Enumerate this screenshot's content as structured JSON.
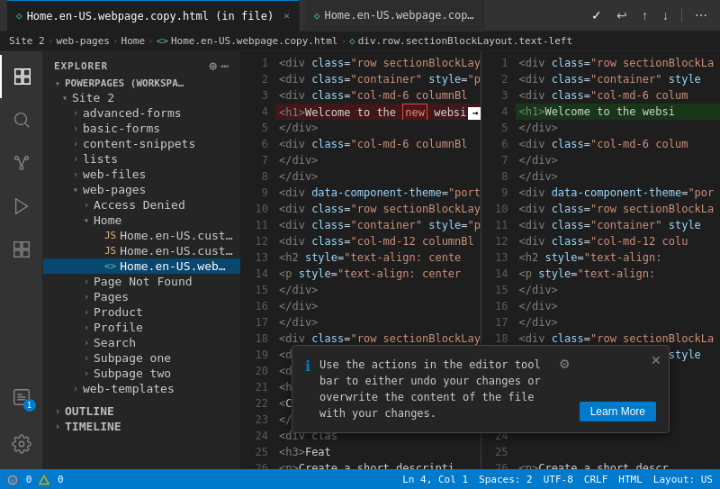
{
  "titlebar": {
    "tab1_icon": "◇",
    "tab1_label": "Home.en-US.webpage.copy.html (in file)",
    "tab2_icon": "◇",
    "tab2_label": "Home.en-US.webpage.cop…",
    "btn_check": "✓",
    "btn_undo": "↩",
    "btn_up": "↑",
    "btn_down": "↓",
    "btn_more": "⋯"
  },
  "breadcrumb": {
    "parts": [
      "Site 2",
      ">",
      "web-pages",
      ">",
      "Home",
      ">",
      "<>",
      "Home.en-US.webpage.copy.html",
      ">",
      "◇",
      "div.row.sectionBlockLayout.text-left"
    ]
  },
  "activitybar": {
    "icons": [
      "⎘",
      "🔍",
      "◉",
      "⑂",
      "🐛",
      "⊞",
      "⚙"
    ],
    "bottom_icons": [
      "🔔",
      "👤"
    ]
  },
  "sidebar": {
    "header": "EXPLORER",
    "workspace": "POWERPAGES (WORKSPA…",
    "items": [
      {
        "label": "Site 2",
        "level": 1,
        "expanded": true,
        "arrow": "▾"
      },
      {
        "label": "advanced-forms",
        "level": 2,
        "expanded": false,
        "arrow": "›"
      },
      {
        "label": "basic-forms",
        "level": 2,
        "expanded": false,
        "arrow": "›"
      },
      {
        "label": "content-snippets",
        "level": 2,
        "expanded": false,
        "arrow": "›"
      },
      {
        "label": "lists",
        "level": 2,
        "expanded": false,
        "arrow": "›"
      },
      {
        "label": "web-files",
        "level": 2,
        "expanded": false,
        "arrow": "›"
      },
      {
        "label": "web-pages",
        "level": 2,
        "expanded": true,
        "arrow": "▾"
      },
      {
        "label": "Access Denied",
        "level": 3,
        "expanded": false,
        "arrow": "›"
      },
      {
        "label": "Home",
        "level": 3,
        "expanded": true,
        "arrow": "▾"
      },
      {
        "label": "Home.en-US.cust…",
        "level": 4,
        "expanded": false,
        "arrow": "",
        "icon": "JS"
      },
      {
        "label": "Home.en-US.cust…",
        "level": 4,
        "expanded": false,
        "arrow": "",
        "icon": "JS"
      },
      {
        "label": "Home.en-US.web…",
        "level": 4,
        "expanded": false,
        "arrow": "",
        "icon": "<>",
        "selected": true
      },
      {
        "label": "Page Not Found",
        "level": 3,
        "expanded": false,
        "arrow": "›"
      },
      {
        "label": "Pages",
        "level": 3,
        "expanded": false,
        "arrow": "›"
      },
      {
        "label": "Product",
        "level": 3,
        "expanded": false,
        "arrow": "›"
      },
      {
        "label": "Profile",
        "level": 3,
        "expanded": false,
        "arrow": "›"
      },
      {
        "label": "Search",
        "level": 3,
        "expanded": false,
        "arrow": "›"
      },
      {
        "label": "Subpage one",
        "level": 3,
        "expanded": false,
        "arrow": "›"
      },
      {
        "label": "Subpage two",
        "level": 3,
        "expanded": false,
        "arrow": "›"
      },
      {
        "label": "web-templates",
        "level": 2,
        "expanded": false,
        "arrow": "›"
      }
    ],
    "outline": "OUTLINE",
    "timeline": "TIMELINE"
  },
  "code_left": {
    "lines": [
      {
        "num": 1,
        "text": "  <div class=\"row sectionBlockLayou"
      },
      {
        "num": 2,
        "text": "    <div class=\"container\" style=\"p"
      },
      {
        "num": 3,
        "text": "      <div class=\"col-md-6 columnBl"
      },
      {
        "num": 4,
        "text": "        <h1>Welcome to the new websi",
        "highlight": "red"
      },
      {
        "num": 5,
        "text": "      </div>"
      },
      {
        "num": 6,
        "text": "      <div class=\"col-md-6 columnBl"
      },
      {
        "num": 7,
        "text": "    </div>"
      },
      {
        "num": 8,
        "text": "  </div>"
      },
      {
        "num": 9,
        "text": "  <div data-component-theme=\"portal"
      },
      {
        "num": 10,
        "text": "    <div class=\"row sectionBlockLayou"
      },
      {
        "num": 11,
        "text": "      <div class=\"container\" style=\"p"
      },
      {
        "num": 12,
        "text": "        <div class=\"col-md-12 columnBl"
      },
      {
        "num": 13,
        "text": "          <h2 style=\"text-align: cente"
      },
      {
        "num": 14,
        "text": "          <p style=\"text-align: center"
      },
      {
        "num": 15,
        "text": "        </div>"
      },
      {
        "num": 16,
        "text": "      </div>"
      },
      {
        "num": 17,
        "text": "  </div>"
      },
      {
        "num": 18,
        "text": "  <div class=\"row sectionBlockLayou"
      },
      {
        "num": 19,
        "text": "    <div class=\"container\" style=\"p"
      },
      {
        "num": 20,
        "text": "      <div class"
      },
      {
        "num": 21,
        "text": "        <h3>Feat"
      },
      {
        "num": 22,
        "text": "        <Creat"
      },
      {
        "num": 23,
        "text": "      </div>"
      },
      {
        "num": 24,
        "text": "      <div clas"
      },
      {
        "num": 25,
        "text": "        <h3>Feat"
      },
      {
        "num": 26,
        "text": "        <p>Create a short descripti"
      }
    ]
  },
  "code_right": {
    "lines": [
      {
        "num": 1,
        "text": "  <div class=\"row sectionBlockLa"
      },
      {
        "num": 2,
        "text": "    <div class=\"container\" style"
      },
      {
        "num": 3,
        "text": "      <div class=\"col-md-6 colum"
      },
      {
        "num": 4,
        "text": "        <h1>Welcome to the websi",
        "highlight": "green"
      },
      {
        "num": 5,
        "text": "      </div>"
      },
      {
        "num": 6,
        "text": "      <div class=\"col-md-6 colum"
      },
      {
        "num": 7,
        "text": "    </div>"
      },
      {
        "num": 8,
        "text": "  </div>"
      },
      {
        "num": 9,
        "text": "  <div data-component-theme=\"por"
      },
      {
        "num": 10,
        "text": "    <div class=\"row sectionBlockLa"
      },
      {
        "num": 11,
        "text": "      <div class=\"container\" style"
      },
      {
        "num": 12,
        "text": "        <div class=\"col-md-12 colu"
      },
      {
        "num": 13,
        "text": "          <h2 style=\"text-align:"
      },
      {
        "num": 14,
        "text": "          <p style=\"text-align:"
      },
      {
        "num": 15,
        "text": "        </div>"
      },
      {
        "num": 16,
        "text": "      </div>"
      },
      {
        "num": 17,
        "text": "  </div>"
      },
      {
        "num": 18,
        "text": "  <div class=\"row sectionBlockLa"
      },
      {
        "num": 19,
        "text": "    <div class=\"container\" style"
      },
      {
        "num": 20,
        "text": ""
      },
      {
        "num": 21,
        "text": ""
      },
      {
        "num": 22,
        "text": ""
      },
      {
        "num": 23,
        "text": ""
      },
      {
        "num": 24,
        "text": ""
      },
      {
        "num": 25,
        "text": ""
      },
      {
        "num": 26,
        "text": "        <p>Create a short descr"
      }
    ]
  },
  "notification": {
    "icon": "ℹ",
    "text": "Use the actions in the editor tool bar to either undo your changes or overwrite the content of the file with your changes.",
    "gear_icon": "⚙",
    "close_icon": "✕",
    "learn_more": "Learn More"
  },
  "statusbar": {
    "errors": "0",
    "warnings": "0",
    "ln": "Ln 4, Col 1",
    "spaces": "Spaces: 2",
    "encoding": "UTF-8",
    "eol": "CRLF",
    "lang": "HTML",
    "layout": "Layout: US"
  }
}
